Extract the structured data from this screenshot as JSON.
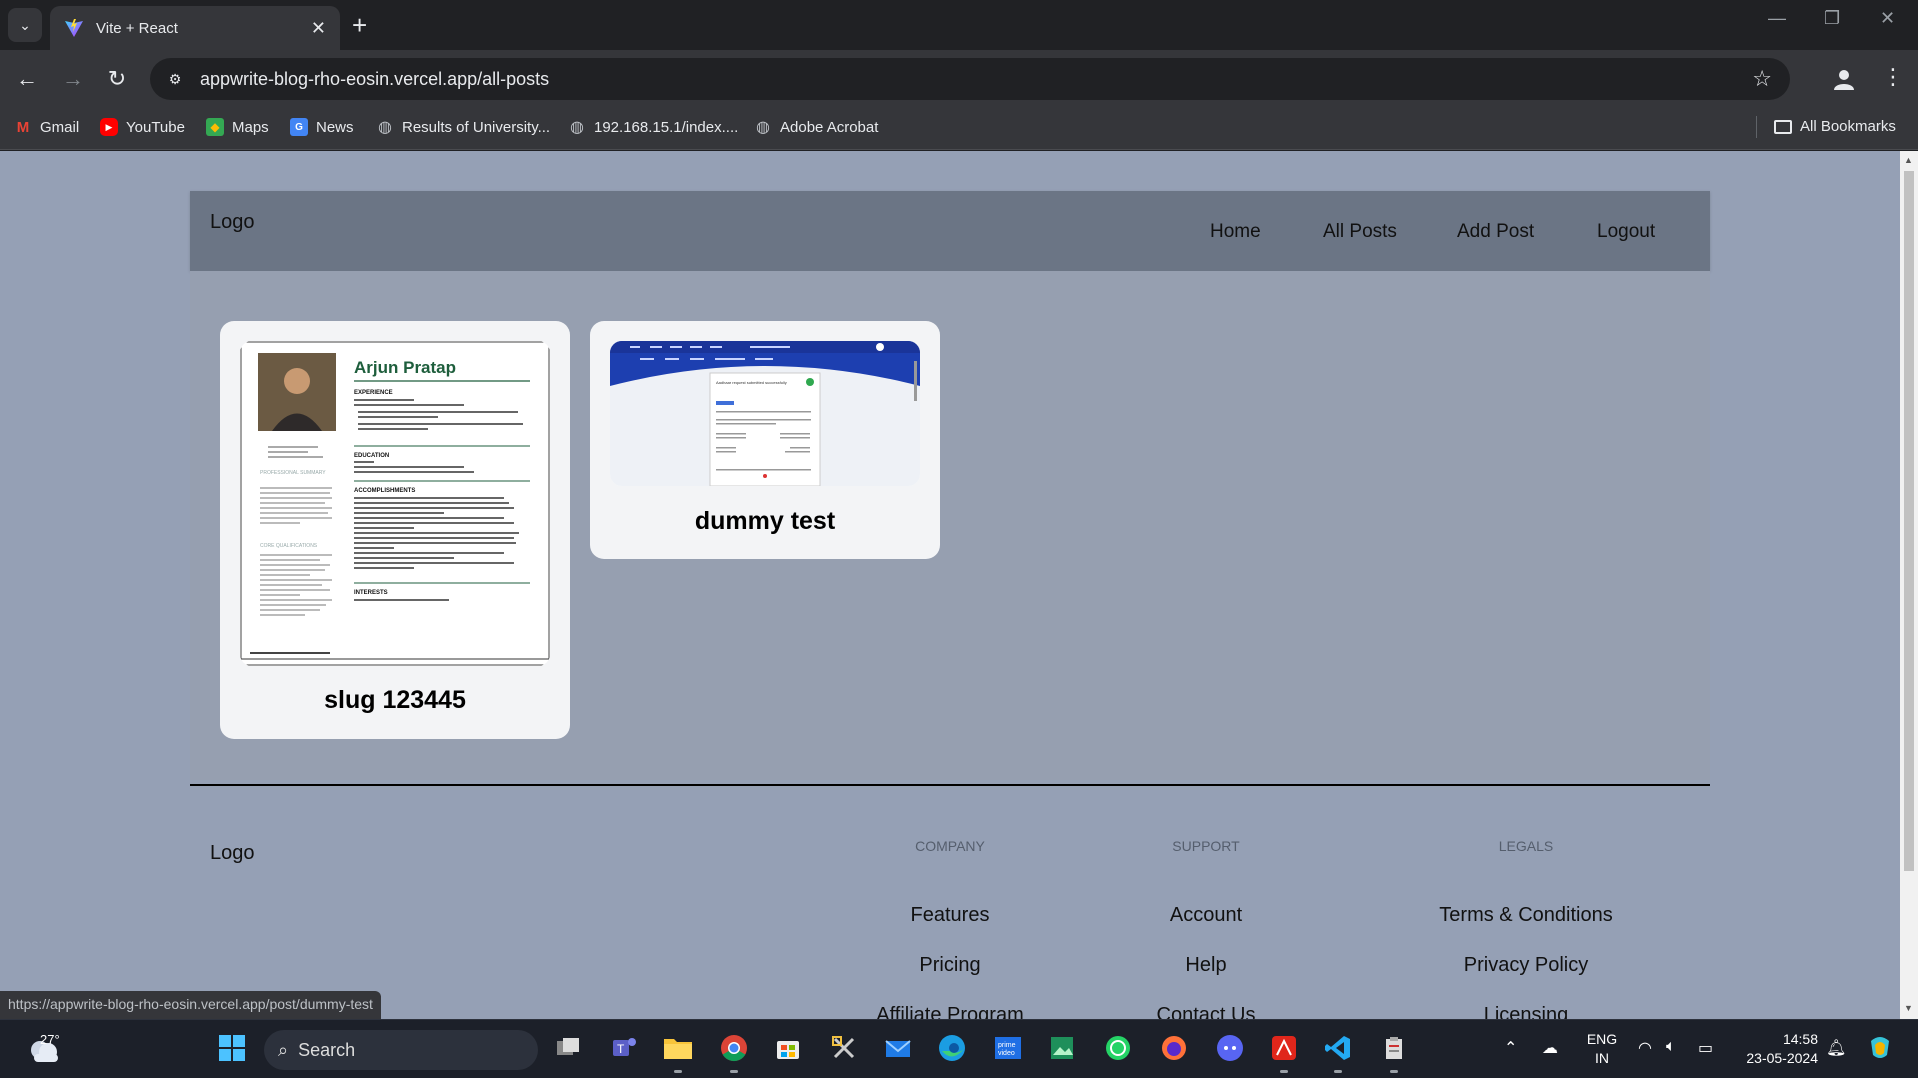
{
  "browser": {
    "tab_title": "Vite + React",
    "url": "appwrite-blog-rho-eosin.vercel.app/all-posts",
    "bookmarks": [
      {
        "label": "Gmail",
        "icon": "gmail-icon"
      },
      {
        "label": "YouTube",
        "icon": "youtube-icon"
      },
      {
        "label": "Maps",
        "icon": "maps-icon"
      },
      {
        "label": "News",
        "icon": "news-icon"
      },
      {
        "label": "Results of University...",
        "icon": "globe-icon"
      },
      {
        "label": "192.168.15.1/index....",
        "icon": "globe-icon"
      },
      {
        "label": "Adobe Acrobat",
        "icon": "globe-icon"
      }
    ],
    "all_bookmarks_label": "All Bookmarks",
    "status_url": "https://appwrite-blog-rho-eosin.vercel.app/post/dummy-test"
  },
  "site": {
    "logo": "Logo",
    "nav": [
      "Home",
      "All Posts",
      "Add Post",
      "Logout"
    ],
    "posts": [
      {
        "title": "slug 123445",
        "resume": {
          "name": "Arjun Pratap",
          "sections": [
            "EXPERIENCE",
            "EDUCATION",
            "ACCOMPLISHMENTS",
            "INTERESTS"
          ],
          "sidebar_sections": [
            "PROFESSIONAL SUMMARY",
            "CORE QUALIFICATIONS"
          ]
        }
      },
      {
        "title": "dummy test",
        "thumb_heading": "Aadhaar request submitted successfully"
      }
    ],
    "footer": {
      "logo": "Logo",
      "columns": [
        {
          "heading": "Company",
          "links": [
            "Features",
            "Pricing",
            "Affiliate Program"
          ]
        },
        {
          "heading": "Support",
          "links": [
            "Account",
            "Help",
            "Contact Us"
          ]
        },
        {
          "heading": "Legals",
          "links": [
            "Terms & Conditions",
            "Privacy Policy",
            "Licensing"
          ]
        }
      ]
    }
  },
  "taskbar": {
    "temperature": "27°",
    "search_label": "Search",
    "lang_top": "ENG",
    "lang_bottom": "IN",
    "time": "14:58",
    "date": "23-05-2024"
  },
  "colors": {
    "page_bg": "#95a0b5",
    "header_bg": "#6b7585",
    "card_bg": "#f3f4f6",
    "chrome_dark": "#202124",
    "chrome_toolbar": "#35363a",
    "taskbar_bg": "#1c2029"
  }
}
